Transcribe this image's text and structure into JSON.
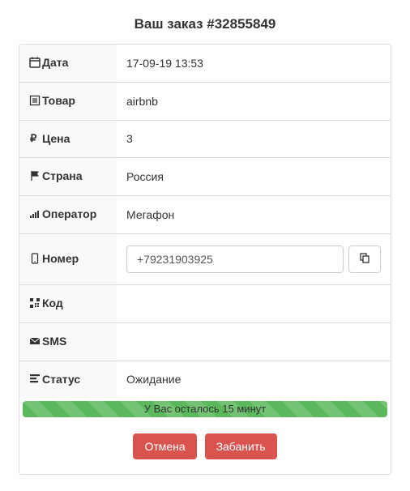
{
  "title": "Ваш заказ #32855849",
  "labels": {
    "date": "Дата",
    "product": "Товар",
    "price": "Цена",
    "country": "Страна",
    "operator": "Оператор",
    "number": "Номер",
    "code": "Код",
    "sms": "SMS",
    "status": "Статус"
  },
  "values": {
    "date": "17-09-19 13:53",
    "product": "airbnb",
    "price": "3",
    "country": "Россия",
    "operator": "Мегафон",
    "number": "+79231903925",
    "code": "",
    "sms": "",
    "status": "Ожидание"
  },
  "progress_text": "У Вас осталось 15 минут",
  "buttons": {
    "cancel": "Отмена",
    "ban": "Забанить"
  }
}
